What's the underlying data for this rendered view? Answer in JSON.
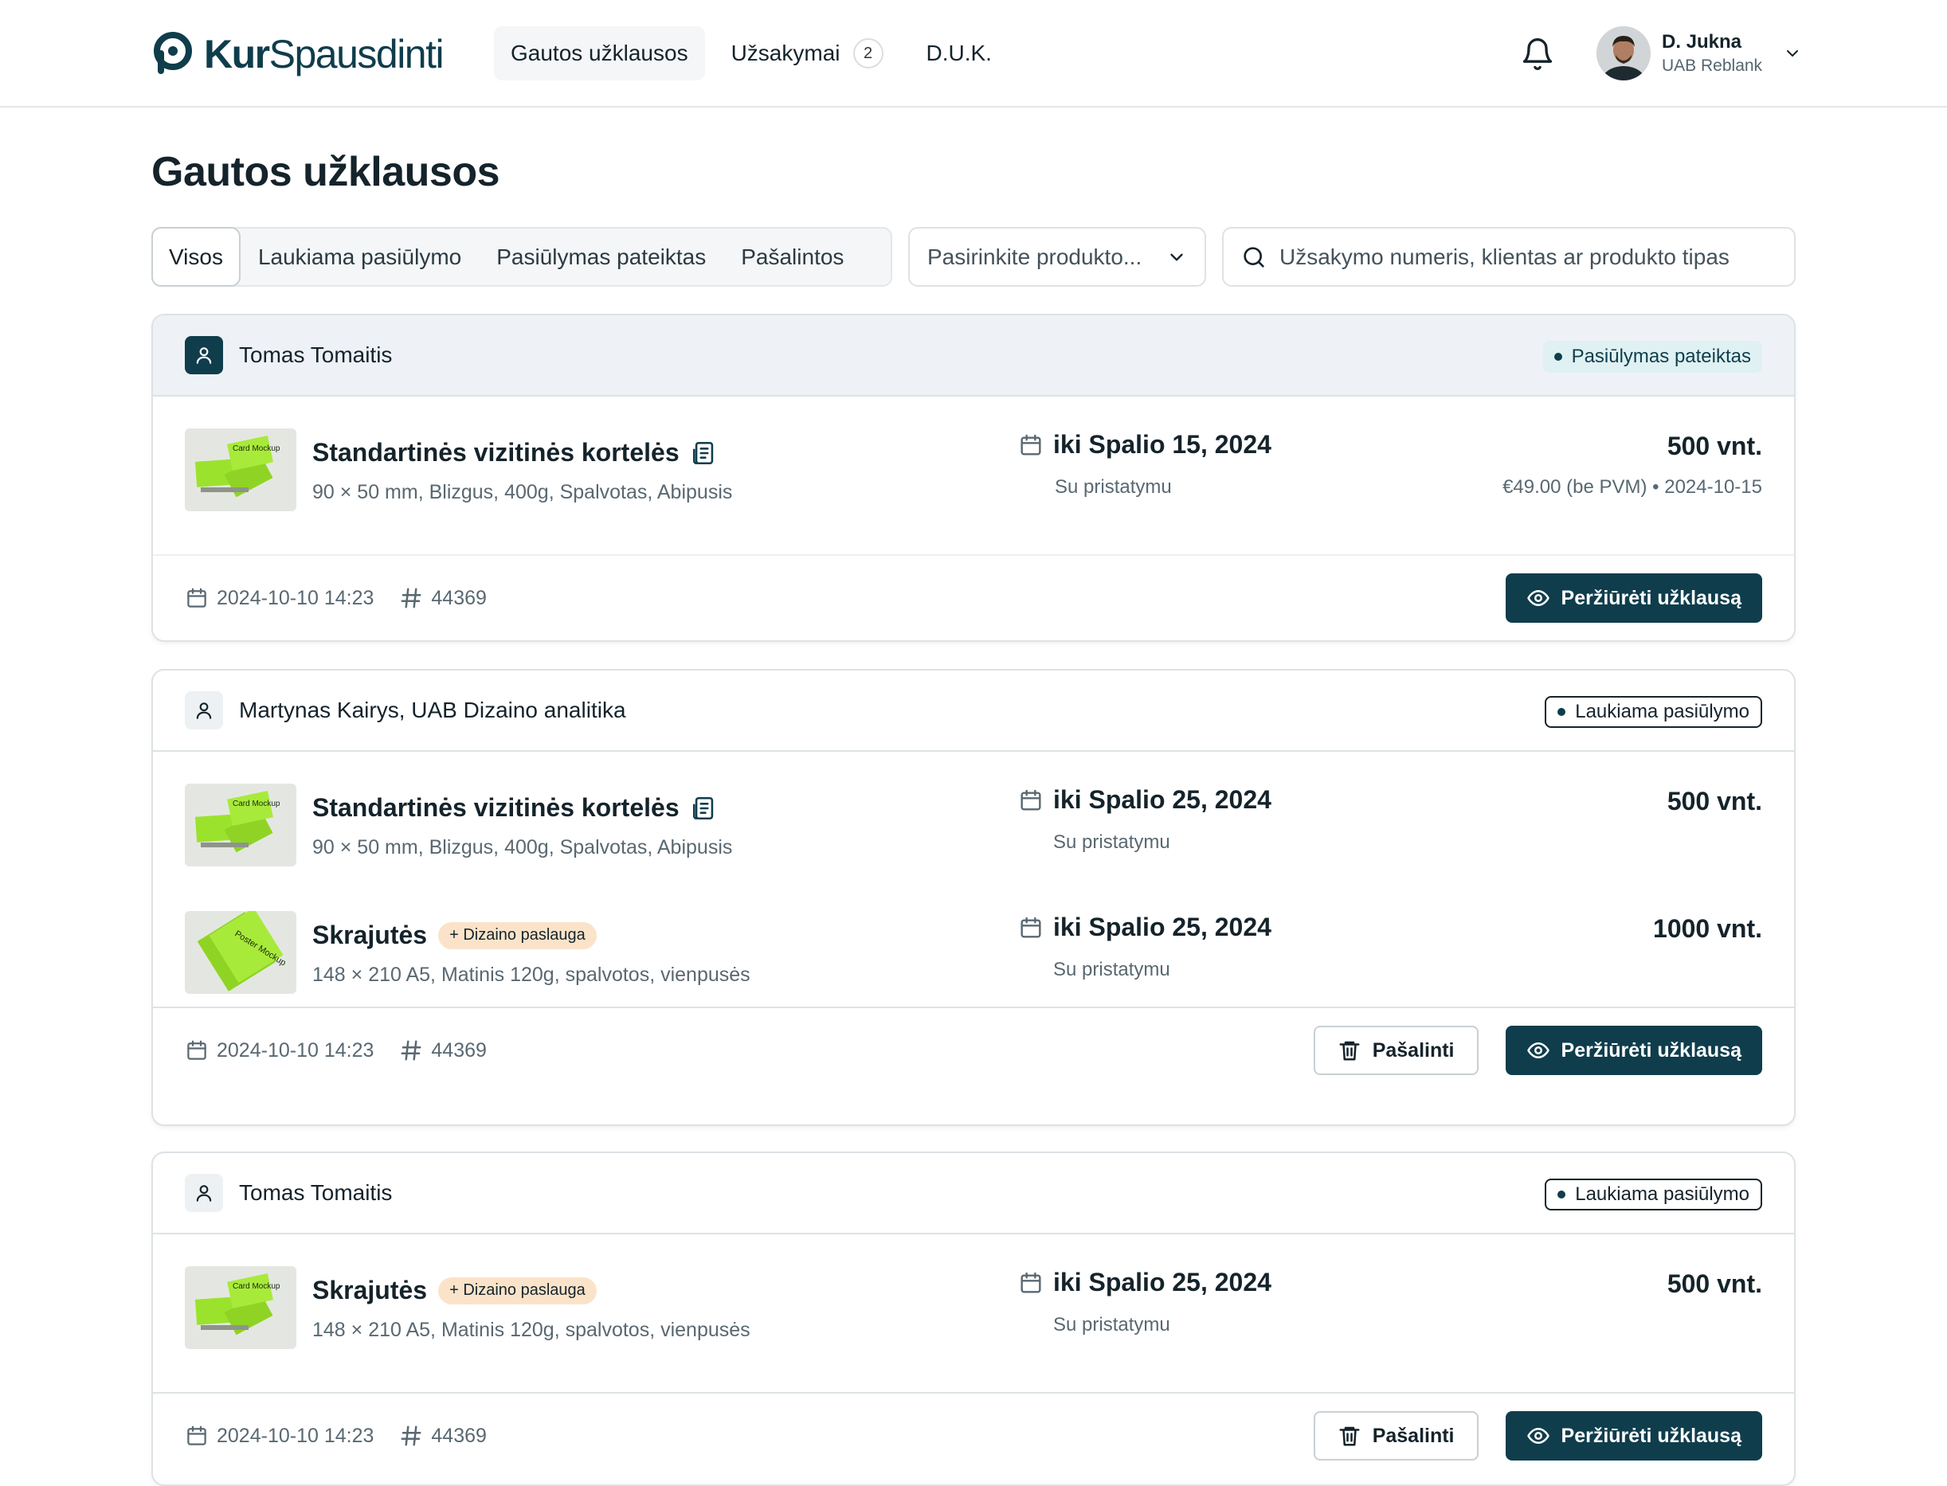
{
  "brand": {
    "name_bold": "Kur",
    "name_rest": "Spausdinti"
  },
  "nav": {
    "items": [
      {
        "label": "Gautos užklausos"
      },
      {
        "label": "Užsakymai",
        "badge": "2"
      },
      {
        "label": "D.U.K."
      }
    ]
  },
  "user": {
    "name": "D. Jukna",
    "company": "UAB Reblank"
  },
  "page": {
    "title": "Gautos užklausos"
  },
  "filters": {
    "tabs": [
      "Visos",
      "Laukiama pasiūlymo",
      "Pasiūlymas pateiktas",
      "Pašalintos"
    ],
    "product_select": "Pasirinkite produkto...",
    "search_placeholder": "Užsakymo numeris, klientas ar produkto tipas"
  },
  "colors": {
    "primary": "#0f3d4c",
    "accent_green": "#9be22d",
    "tag_bg": "#fbe3c9",
    "offer_badge_bg": "#dff1f2"
  },
  "requests": [
    {
      "client": "Tomas Tomaitis",
      "status": "Pasiūlymas pateiktas",
      "items": [
        {
          "name": "Standartinės vizitinės kortelės",
          "spec": "90 × 50 mm, Blizgus, 400g, Spalvotas, Abipusis",
          "deadline": "iki Spalio 15, 2024",
          "delivery": "Su pristatymu",
          "quantity": "500 vnt.",
          "price": "€49.00 (be PVM) • 2024-10-15",
          "thumb_text": "Card Mockup"
        }
      ],
      "created": "2024-10-10 14:23",
      "number": "44369",
      "view_label": "Peržiūrėti užklausą"
    },
    {
      "client": "Martynas Kairys, UAB Dizaino analitika",
      "status": "Laukiama pasiūlymo",
      "items": [
        {
          "name": "Standartinės vizitinės kortelės",
          "spec": "90 × 50 mm, Blizgus, 400g, Spalvotas, Abipusis",
          "deadline": "iki Spalio 25, 2024",
          "delivery": "Su pristatymu",
          "quantity": "500 vnt.",
          "thumb_text": "Card Mockup"
        },
        {
          "name": "Skrajutės",
          "tag": "+ Dizaino paslauga",
          "spec": "148 × 210 A5, Matinis 120g, spalvotos, vienpusės",
          "deadline": "iki Spalio 25, 2024",
          "delivery": "Su pristatymu",
          "quantity": "1000 vnt.",
          "thumb_text": "Poster Mockup"
        }
      ],
      "created": "2024-10-10 14:23",
      "number": "44369",
      "remove_label": "Pašalinti",
      "view_label": "Peržiūrėti užklausą"
    },
    {
      "client": "Tomas Tomaitis",
      "status": "Laukiama pasiūlymo",
      "items": [
        {
          "name": "Skrajutės",
          "tag": "+ Dizaino paslauga",
          "spec": "148 × 210 A5, Matinis 120g, spalvotos, vienpusės",
          "deadline": "iki Spalio 25, 2024",
          "delivery": "Su pristatymu",
          "quantity": "500 vnt.",
          "thumb_text": "Card Mockup"
        }
      ],
      "created": "2024-10-10 14:23",
      "number": "44369",
      "remove_label": "Pašalinti",
      "view_label": "Peržiūrėti užklausą"
    }
  ]
}
